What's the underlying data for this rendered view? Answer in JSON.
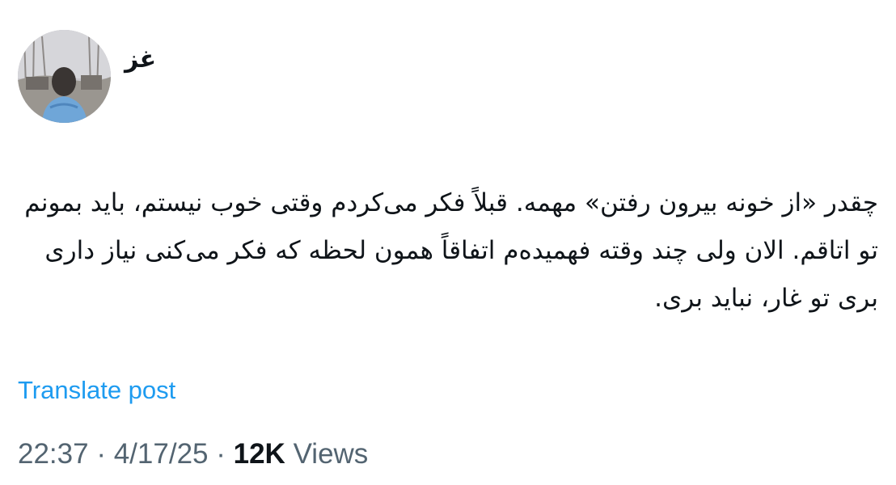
{
  "author": {
    "display_name": "غز",
    "avatar_icon": "user-avatar-photo"
  },
  "post": {
    "text": "چقدر «از خونه بیرون رفتن» مهمه. قبلاً فکر می‌کردم وقتی خوب نیستم، باید بمونم تو اتاقم. الان ولی چند وقته فهمیده‌م اتفاقاً همون لحظه که فکر می‌کنی نیاز داری بری تو غار، نباید بری.",
    "translate_label": "Translate post"
  },
  "meta": {
    "time": "22:37",
    "separator": "·",
    "date": "4/17/25",
    "views_count": "12K",
    "views_label": "Views"
  },
  "colors": {
    "link": "#1d9bf0",
    "text_primary": "#0f1419",
    "text_secondary": "#536471"
  }
}
